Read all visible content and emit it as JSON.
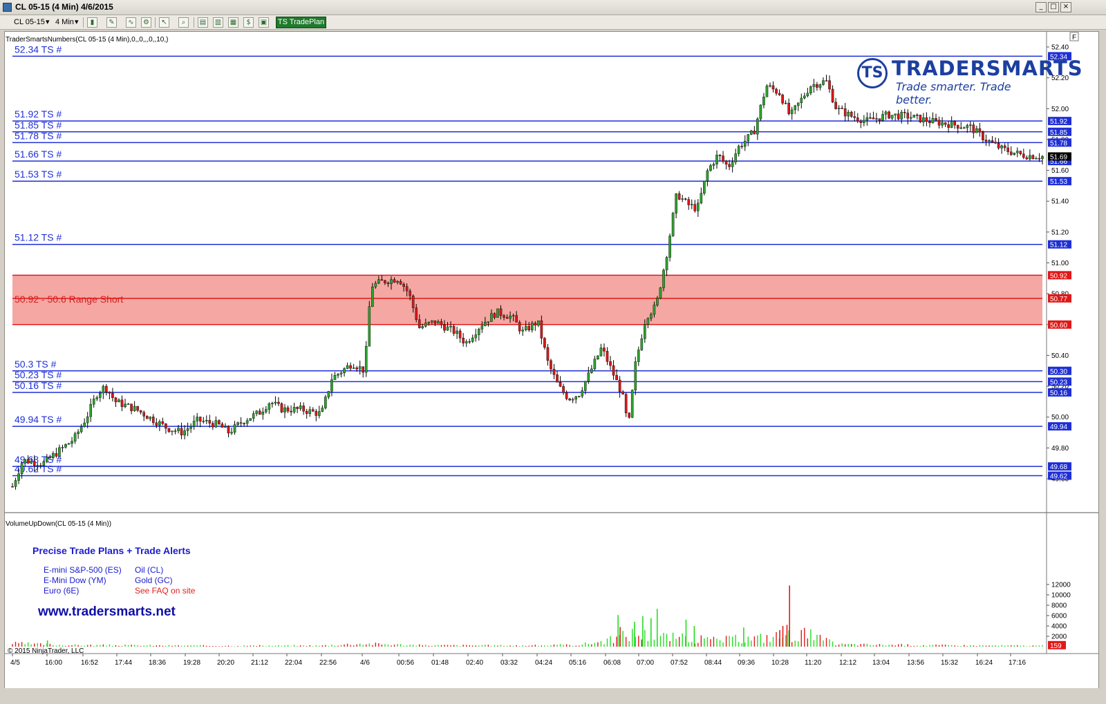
{
  "window": {
    "title": "CL 05-15 (4 Min)  4/6/2015",
    "buttons": [
      "_",
      "□",
      "×"
    ]
  },
  "toolbar": {
    "instrument": "CL 05-15",
    "interval": "4 Min",
    "tradeplan_label": "TS TradePlan"
  },
  "colors": {
    "level_line": "#1f2fd6",
    "range_line": "#e01818",
    "range_fill": "#f4a7a3",
    "up_candle": "#2fa02f",
    "down_candle": "#d81818",
    "volume_up": "#22dd22",
    "volume_down": "#e21818"
  },
  "chart_data": [
    {
      "type": "candlestick",
      "indicator_label": "TraderSmartsNumbers(CL 05-15 (4 Min),0,,0,,,0,,10,)",
      "ylim": [
        49.5,
        52.45
      ],
      "y_ticks": [
        "52.40",
        "52.20",
        "52.00",
        "51.80",
        "51.60",
        "51.40",
        "51.20",
        "51.00",
        "50.80",
        "50.60",
        "50.40",
        "50.20",
        "50.00",
        "49.80",
        "49.60"
      ],
      "x_ticks": [
        "4/5",
        "16:00",
        "16:52",
        "17:44",
        "18:36",
        "19:28",
        "20:20",
        "21:12",
        "22:04",
        "22:56",
        "4/6",
        "00:56",
        "01:48",
        "02:40",
        "03:32",
        "04:24",
        "05:16",
        "06:08",
        "07:00",
        "07:52",
        "08:44",
        "09:36",
        "10:28",
        "11:20",
        "12:12",
        "13:04",
        "13:56",
        "15:32",
        "16:24",
        "17:16"
      ],
      "levels": [
        {
          "label": "52.34 TS #",
          "axis_label": "52.34",
          "value": 52.34
        },
        {
          "label": "51.92 TS #",
          "axis_label": "51.92",
          "value": 51.92
        },
        {
          "label": "51.85 TS #",
          "axis_label": "51.85",
          "value": 51.85
        },
        {
          "label": "51.78 TS #",
          "axis_label": "51.78",
          "value": 51.78
        },
        {
          "label": "51.66 TS #",
          "axis_label": "51.66",
          "value": 51.66
        },
        {
          "label": "51.53 TS #",
          "axis_label": "51.53",
          "value": 51.53
        },
        {
          "label": "51.12 TS #",
          "axis_label": "51.12",
          "value": 51.12
        },
        {
          "label": "50.3 TS #",
          "axis_label": "50.30",
          "value": 50.3
        },
        {
          "label": "50.23 TS #",
          "axis_label": "50.23",
          "value": 50.23
        },
        {
          "label": "50.16 TS #",
          "axis_label": "50.16",
          "value": 50.16
        },
        {
          "label": "49.94 TS #",
          "axis_label": "49.94",
          "value": 49.94
        },
        {
          "label": "49.68 TS #",
          "axis_label": "49.68",
          "value": 49.68
        },
        {
          "label": "49.62 TS #",
          "axis_label": "49.62",
          "value": 49.62
        }
      ],
      "range_zone": {
        "label": "50.92 - 50.6 Range Short",
        "top": 50.92,
        "mid": 50.77,
        "bottom": 50.6,
        "axis_labels": [
          "50.92",
          "50.77",
          "50.60"
        ]
      },
      "last_price": {
        "value": 51.69,
        "label": "51.69"
      },
      "price_path": [
        {
          "x": 0.0,
          "y": 49.55
        },
        {
          "x": 0.01,
          "y": 49.72
        },
        {
          "x": 0.03,
          "y": 49.7
        },
        {
          "x": 0.045,
          "y": 49.78
        },
        {
          "x": 0.06,
          "y": 49.86
        },
        {
          "x": 0.072,
          "y": 50.0
        },
        {
          "x": 0.082,
          "y": 50.15
        },
        {
          "x": 0.09,
          "y": 50.2
        },
        {
          "x": 0.1,
          "y": 50.1
        },
        {
          "x": 0.12,
          "y": 50.05
        },
        {
          "x": 0.135,
          "y": 49.99
        },
        {
          "x": 0.15,
          "y": 49.93
        },
        {
          "x": 0.165,
          "y": 49.9
        },
        {
          "x": 0.18,
          "y": 49.98
        },
        {
          "x": 0.2,
          "y": 49.95
        },
        {
          "x": 0.21,
          "y": 49.9
        },
        {
          "x": 0.225,
          "y": 49.98
        },
        {
          "x": 0.24,
          "y": 50.03
        },
        {
          "x": 0.25,
          "y": 50.1
        },
        {
          "x": 0.262,
          "y": 50.05
        },
        {
          "x": 0.28,
          "y": 50.05
        },
        {
          "x": 0.3,
          "y": 50.02
        },
        {
          "x": 0.31,
          "y": 50.25
        },
        {
          "x": 0.33,
          "y": 50.35
        },
        {
          "x": 0.342,
          "y": 50.3
        },
        {
          "x": 0.348,
          "y": 50.85
        },
        {
          "x": 0.36,
          "y": 50.88
        },
        {
          "x": 0.375,
          "y": 50.9
        },
        {
          "x": 0.385,
          "y": 50.8
        },
        {
          "x": 0.395,
          "y": 50.58
        },
        {
          "x": 0.41,
          "y": 50.62
        },
        {
          "x": 0.43,
          "y": 50.55
        },
        {
          "x": 0.44,
          "y": 50.48
        },
        {
          "x": 0.455,
          "y": 50.6
        },
        {
          "x": 0.47,
          "y": 50.68
        },
        {
          "x": 0.485,
          "y": 50.65
        },
        {
          "x": 0.495,
          "y": 50.55
        },
        {
          "x": 0.51,
          "y": 50.62
        },
        {
          "x": 0.52,
          "y": 50.35
        },
        {
          "x": 0.53,
          "y": 50.2
        },
        {
          "x": 0.54,
          "y": 50.12
        },
        {
          "x": 0.55,
          "y": 50.15
        },
        {
          "x": 0.56,
          "y": 50.28
        },
        {
          "x": 0.572,
          "y": 50.45
        },
        {
          "x": 0.582,
          "y": 50.3
        },
        {
          "x": 0.592,
          "y": 50.15
        },
        {
          "x": 0.598,
          "y": 49.93
        },
        {
          "x": 0.605,
          "y": 50.35
        },
        {
          "x": 0.615,
          "y": 50.65
        },
        {
          "x": 0.625,
          "y": 50.72
        },
        {
          "x": 0.635,
          "y": 51.05
        },
        {
          "x": 0.645,
          "y": 51.45
        },
        {
          "x": 0.655,
          "y": 51.38
        },
        {
          "x": 0.665,
          "y": 51.35
        },
        {
          "x": 0.675,
          "y": 51.6
        },
        {
          "x": 0.685,
          "y": 51.7
        },
        {
          "x": 0.695,
          "y": 51.62
        },
        {
          "x": 0.705,
          "y": 51.75
        },
        {
          "x": 0.72,
          "y": 51.85
        },
        {
          "x": 0.732,
          "y": 52.15
        },
        {
          "x": 0.745,
          "y": 52.1
        },
        {
          "x": 0.755,
          "y": 51.95
        },
        {
          "x": 0.765,
          "y": 52.05
        },
        {
          "x": 0.775,
          "y": 52.15
        },
        {
          "x": 0.79,
          "y": 52.18
        },
        {
          "x": 0.8,
          "y": 52.0
        },
        {
          "x": 0.815,
          "y": 51.95
        },
        {
          "x": 0.83,
          "y": 51.92
        },
        {
          "x": 0.85,
          "y": 51.96
        },
        {
          "x": 0.87,
          "y": 51.95
        },
        {
          "x": 0.89,
          "y": 51.92
        },
        {
          "x": 0.91,
          "y": 51.9
        },
        {
          "x": 0.93,
          "y": 51.88
        },
        {
          "x": 0.945,
          "y": 51.8
        },
        {
          "x": 0.96,
          "y": 51.74
        },
        {
          "x": 0.98,
          "y": 51.7
        },
        {
          "x": 1.0,
          "y": 51.69
        }
      ]
    },
    {
      "type": "bar",
      "indicator_label": "VolumeUpDown(CL 05-15 (4 Min))",
      "ylim": [
        0,
        12500
      ],
      "y_ticks": [
        "12000",
        "10000",
        "8000",
        "6000",
        "4000",
        "2000"
      ],
      "last_volume": {
        "value": 159,
        "label": "159"
      },
      "volume_profile": [
        {
          "x": 0.0,
          "y": 700
        },
        {
          "x": 0.05,
          "y": 350
        },
        {
          "x": 0.1,
          "y": 300
        },
        {
          "x": 0.2,
          "y": 200
        },
        {
          "x": 0.3,
          "y": 250
        },
        {
          "x": 0.34,
          "y": 650
        },
        {
          "x": 0.4,
          "y": 300
        },
        {
          "x": 0.5,
          "y": 250
        },
        {
          "x": 0.55,
          "y": 400
        },
        {
          "x": 0.58,
          "y": 1400
        },
        {
          "x": 0.6,
          "y": 2800
        },
        {
          "x": 0.62,
          "y": 2500
        },
        {
          "x": 0.64,
          "y": 2000
        },
        {
          "x": 0.68,
          "y": 1400
        },
        {
          "x": 0.72,
          "y": 1800
        },
        {
          "x": 0.75,
          "y": 2400
        },
        {
          "x": 0.77,
          "y": 2800
        },
        {
          "x": 0.8,
          "y": 500
        },
        {
          "x": 0.9,
          "y": 300
        },
        {
          "x": 1.0,
          "y": 200
        }
      ],
      "volume_spikes": [
        {
          "x": 0.034,
          "y": 2200,
          "dir": "up"
        },
        {
          "x": 0.588,
          "y": 6100,
          "dir": "up"
        },
        {
          "x": 0.59,
          "y": 3800,
          "dir": "down"
        },
        {
          "x": 0.604,
          "y": 4800,
          "dir": "up"
        },
        {
          "x": 0.612,
          "y": 5900,
          "dir": "up"
        },
        {
          "x": 0.62,
          "y": 5500,
          "dir": "up"
        },
        {
          "x": 0.626,
          "y": 7300,
          "dir": "up"
        },
        {
          "x": 0.654,
          "y": 5200,
          "dir": "up"
        },
        {
          "x": 0.662,
          "y": 4000,
          "dir": "up"
        },
        {
          "x": 0.71,
          "y": 3700,
          "dir": "up"
        },
        {
          "x": 0.745,
          "y": 3200,
          "dir": "down"
        },
        {
          "x": 0.748,
          "y": 4000,
          "dir": "down"
        },
        {
          "x": 0.752,
          "y": 4200,
          "dir": "down"
        },
        {
          "x": 0.7545,
          "y": 11800,
          "dir": "down"
        }
      ]
    }
  ],
  "promo": {
    "title": "Precise Trade Plans + Trade Alerts",
    "col1": [
      "E-mini S&P-500 (ES)",
      "E-Mini Dow (YM)",
      "Euro (6E)"
    ],
    "col2": [
      "Oil (CL)",
      "Gold (GC)"
    ],
    "faq": "See FAQ on site",
    "url": "www.tradersmarts.net"
  },
  "logo": {
    "mark": "TS",
    "name": "TRADERSMARTS",
    "tagline": "Trade smarter. Trade better."
  },
  "copyright": "© 2015 NinjaTrader, LLC",
  "panel_marker": "F"
}
